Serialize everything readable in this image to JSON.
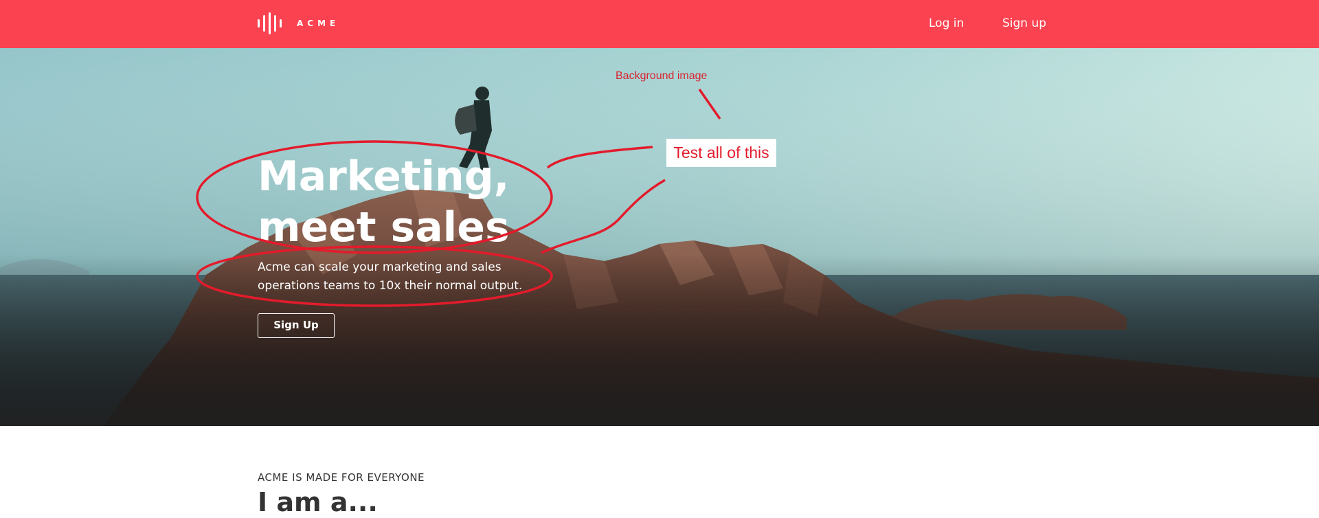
{
  "header": {
    "brand": "ACME",
    "nav": [
      {
        "label": "Log in"
      },
      {
        "label": "Sign up"
      }
    ],
    "bg_color": "#fb4250"
  },
  "hero": {
    "title": "Marketing,\nmeet sales",
    "subtitle": "Acme can scale your marketing and sales operations teams to 10x their normal output.",
    "cta_label": "Sign Up"
  },
  "annotations": {
    "background_label": "Background image",
    "callout": "Test all of this",
    "color": "#e31b2b"
  },
  "section": {
    "eyebrow": "ACME IS MADE FOR EVERYONE",
    "heading": "I am a..."
  }
}
